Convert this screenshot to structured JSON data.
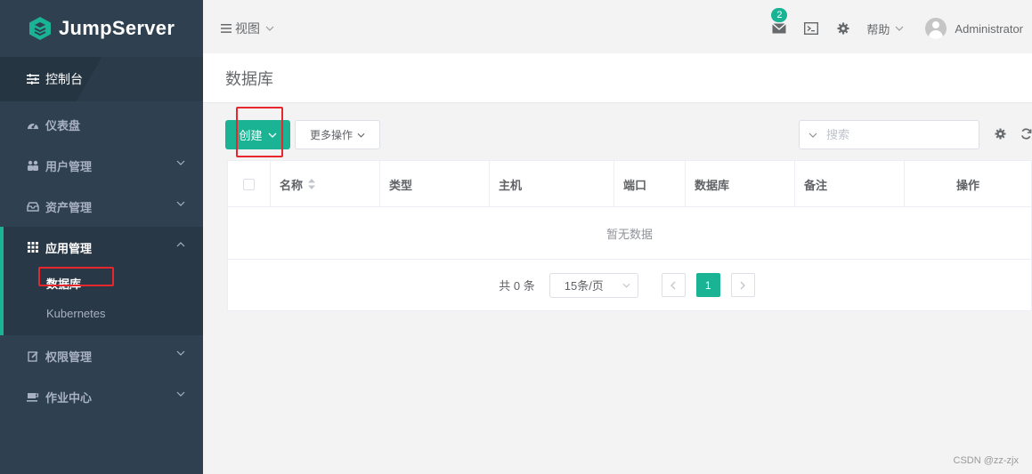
{
  "brand": {
    "name": "JumpServer"
  },
  "sidebar": {
    "console_label": "控制台",
    "items": [
      {
        "label": "仪表盘",
        "icon": "dashboard-icon"
      },
      {
        "label": "用户管理",
        "icon": "users-icon"
      },
      {
        "label": "资产管理",
        "icon": "inbox-icon"
      },
      {
        "label": "应用管理",
        "icon": "grid-icon",
        "expanded": true,
        "children": [
          {
            "label": "数据库",
            "active": true
          },
          {
            "label": "Kubernetes"
          }
        ]
      },
      {
        "label": "权限管理",
        "icon": "edit-icon"
      },
      {
        "label": "作业中心",
        "icon": "coffee-icon"
      }
    ]
  },
  "topbar": {
    "view_label": "视图",
    "mail_badge": "2",
    "help_label": "帮助",
    "user_name": "Administrator"
  },
  "page": {
    "title": "数据库"
  },
  "toolbar": {
    "create_label": "创建",
    "more_label": "更多操作",
    "search_placeholder": "搜索"
  },
  "table": {
    "columns": [
      "名称",
      "类型",
      "主机",
      "端口",
      "数据库",
      "备注",
      "操作"
    ],
    "empty_text": "暂无数据"
  },
  "pagination": {
    "total_text": "共 0 条",
    "page_size": "15条/页",
    "current_page": "1"
  },
  "colors": {
    "sidebar": "#2f4050",
    "accent": "#1ab394",
    "annotation": "#e8262d"
  },
  "watermark": "CSDN @zz-zjx"
}
